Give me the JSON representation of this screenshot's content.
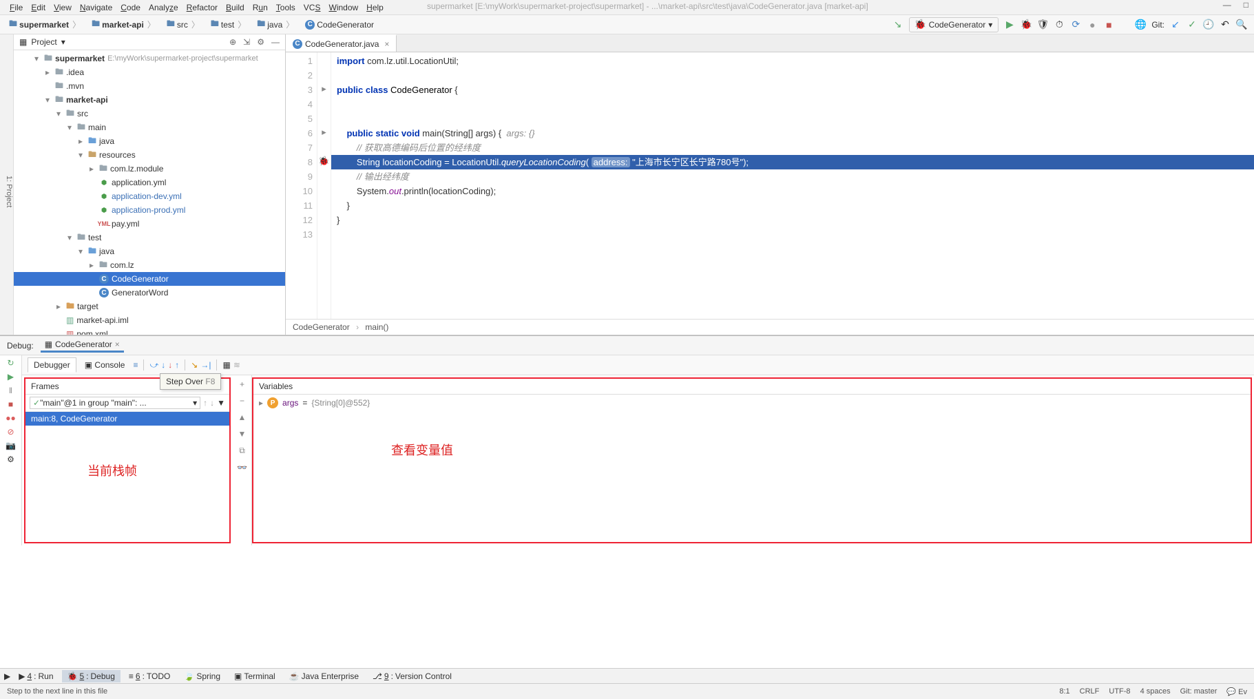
{
  "menu": [
    "File",
    "Edit",
    "View",
    "Navigate",
    "Code",
    "Analyze",
    "Refactor",
    "Build",
    "Run",
    "Tools",
    "VCS",
    "Window",
    "Help"
  ],
  "title_path": "supermarket [E:\\myWork\\supermarket-project\\supermarket] - ...\\market-api\\src\\test\\java\\CodeGenerator.java [market-api]",
  "breadcrumb": [
    {
      "icon": "folder",
      "label": "supermarket",
      "bold": true
    },
    {
      "icon": "folder",
      "label": "market-api",
      "bold": true
    },
    {
      "icon": "folder",
      "label": "src"
    },
    {
      "icon": "folder",
      "label": "test"
    },
    {
      "icon": "folder",
      "label": "java"
    },
    {
      "icon": "class",
      "label": "CodeGenerator"
    }
  ],
  "run_config": "CodeGenerator",
  "git_label": "Git:",
  "project": {
    "title": "Project",
    "root_label": "supermarket",
    "root_path": "E:\\myWork\\supermarket-project\\supermarket",
    "tree": [
      {
        "d": 1,
        "a": "▾",
        "i": "folder-root",
        "t": "supermarket",
        "extra": "E:\\myWork\\supermarket-project\\supermarket",
        "bold": true
      },
      {
        "d": 2,
        "a": "▸",
        "i": "folder",
        "t": ".idea"
      },
      {
        "d": 2,
        "a": "",
        "i": "folder",
        "t": ".mvn"
      },
      {
        "d": 2,
        "a": "▾",
        "i": "folder",
        "t": "market-api",
        "bold": true
      },
      {
        "d": 3,
        "a": "▾",
        "i": "folder",
        "t": "src"
      },
      {
        "d": 4,
        "a": "▾",
        "i": "folder",
        "t": "main"
      },
      {
        "d": 5,
        "a": "▸",
        "i": "folder-src",
        "t": "java"
      },
      {
        "d": 5,
        "a": "▾",
        "i": "folder-res",
        "t": "resources"
      },
      {
        "d": 6,
        "a": "▸",
        "i": "folder",
        "t": "com.lz.module"
      },
      {
        "d": 6,
        "a": "",
        "i": "yml-g",
        "t": "application.yml"
      },
      {
        "d": 6,
        "a": "",
        "i": "yml-g",
        "t": "application-dev.yml",
        "link": true
      },
      {
        "d": 6,
        "a": "",
        "i": "yml-g",
        "t": "application-prod.yml",
        "link": true
      },
      {
        "d": 6,
        "a": "",
        "i": "yml-r",
        "t": "pay.yml"
      },
      {
        "d": 4,
        "a": "▾",
        "i": "folder",
        "t": "test"
      },
      {
        "d": 5,
        "a": "▾",
        "i": "folder-src",
        "t": "java"
      },
      {
        "d": 6,
        "a": "▸",
        "i": "folder",
        "t": "com.lz"
      },
      {
        "d": 6,
        "a": "",
        "i": "class",
        "t": "CodeGenerator",
        "sel": true
      },
      {
        "d": 6,
        "a": "",
        "i": "class",
        "t": "GeneratorWord"
      },
      {
        "d": 3,
        "a": "▸",
        "i": "folder-y",
        "t": "target"
      },
      {
        "d": 3,
        "a": "",
        "i": "iml",
        "t": "market-api.iml"
      },
      {
        "d": 3,
        "a": "",
        "i": "xml",
        "t": "pom.xml"
      }
    ]
  },
  "editor_tab": "CodeGenerator.java",
  "code_lines": [
    {
      "n": 1,
      "html": "<span class='kw'>import</span> com.lz.util.LocationUtil;"
    },
    {
      "n": 2,
      "html": ""
    },
    {
      "n": 3,
      "html": "<span class='kw'>public class</span> <span class='typ'>CodeGenerator</span> {",
      "m": "▸"
    },
    {
      "n": 4,
      "html": ""
    },
    {
      "n": 5,
      "html": ""
    },
    {
      "n": 6,
      "html": "    <span class='kw'>public static void</span> main(String[] args) {  <span class='cm'>args: {}</span>",
      "m": "▸"
    },
    {
      "n": 7,
      "html": "        <span class='cm'>// 获取高德编码后位置的经纬度</span>"
    },
    {
      "n": 8,
      "html": "        String locationCoding = LocationUtil.<span class='fn'>queryLocationCoding</span>( <span class='param-hint'>address:</span> <span class='str'>\"上海市长宁区长宁路780号\"</span>);",
      "hl": true,
      "bp": true
    },
    {
      "n": 9,
      "html": "        <span class='cm'>// 输出经纬度</span>"
    },
    {
      "n": 10,
      "html": "        System.<span class='fld'>out</span>.println(locationCoding);"
    },
    {
      "n": 11,
      "html": "    }"
    },
    {
      "n": 12,
      "html": "}"
    },
    {
      "n": 13,
      "html": ""
    }
  ],
  "editor_crumbs": [
    "CodeGenerator",
    "main()"
  ],
  "debug": {
    "title": "Debug:",
    "session": "CodeGenerator",
    "tabs": {
      "debugger": "Debugger",
      "console": "Console"
    },
    "step_tooltip": "Step Over",
    "step_key": "F8",
    "frames_title": "Frames",
    "thread": "\"main\"@1 in group \"main\": ...",
    "frame": "main:8, CodeGenerator",
    "anno_frames": "当前栈帧",
    "vars_title": "Variables",
    "var_name": "args",
    "var_eq": " = ",
    "var_val": "{String[0]@552}",
    "anno_vars": "查看变量值"
  },
  "bottom_bar": [
    {
      "k": "4",
      "t": "Run",
      "i": "▶"
    },
    {
      "k": "5",
      "t": "Debug",
      "i": "🐞",
      "active": true
    },
    {
      "k": "6",
      "t": "TODO",
      "i": "≡"
    },
    {
      "k": "",
      "t": "Spring",
      "i": "🍃"
    },
    {
      "k": "",
      "t": "Terminal",
      "i": "▣"
    },
    {
      "k": "",
      "t": "Java Enterprise",
      "i": "☕"
    },
    {
      "k": "9",
      "t": "Version Control",
      "i": "⎇"
    }
  ],
  "status": {
    "left": "Step to the next line in this file",
    "pos": "8:1",
    "sep": "CRLF",
    "enc": "UTF-8",
    "indent": "4 spaces",
    "git": "Git: master",
    "ev": "Ev"
  }
}
